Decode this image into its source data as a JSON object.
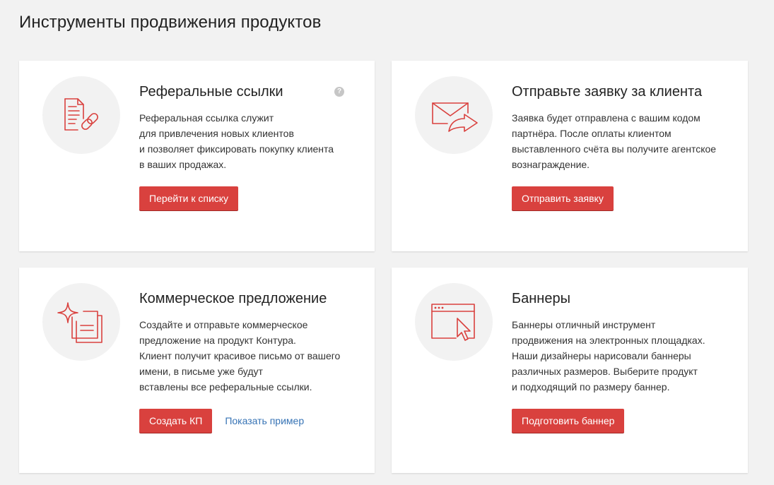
{
  "page": {
    "title": "Инструменты продвижения продуктов"
  },
  "colors": {
    "accent": "#d9413e",
    "link": "#3673b5",
    "background": "#f2f2f2"
  },
  "cards": [
    {
      "icon": "document-link-icon",
      "title_lines": [
        "Реферальные ссылки"
      ],
      "has_help": true,
      "help_glyph": "?",
      "text_lines": [
        "Реферальная ссылка служит",
        "для привлечения новых клиентов",
        "и позволяет фиксировать покупку клиента",
        "в ваших продажах."
      ],
      "button_label": "Перейти к списку"
    },
    {
      "icon": "envelope-send-icon",
      "title_lines": [
        "Отправьте заявку",
        "за клиента"
      ],
      "text_lines": [
        "Заявка будет отправлена с вашим кодом",
        "партнёра. После оплаты клиентом",
        "выставленного счёта вы получите агентское",
        "вознаграждение."
      ],
      "button_label": "Отправить заявку"
    },
    {
      "icon": "sparkle-documents-icon",
      "title_lines": [
        "Коммерческое",
        "предложение"
      ],
      "text_lines": [
        "Создайте и отправьте коммерческое",
        "предложение на продукт Контура.",
        "Клиент получит красивое письмо от вашего",
        "имени, в письме уже будут",
        "вставлены все реферальные ссылки."
      ],
      "button_label": "Создать КП",
      "link_label": "Показать пример"
    },
    {
      "icon": "browser-cursor-icon",
      "title_lines": [
        "Баннеры"
      ],
      "text_lines": [
        "Баннеры отличный инструмент",
        "продвижения на электронных площадках.",
        "Наши дизайнеры нарисовали баннеры",
        "различных размеров. Выберите продукт",
        "и подходящий по размеру баннер."
      ],
      "button_label": "Подготовить баннер"
    }
  ]
}
